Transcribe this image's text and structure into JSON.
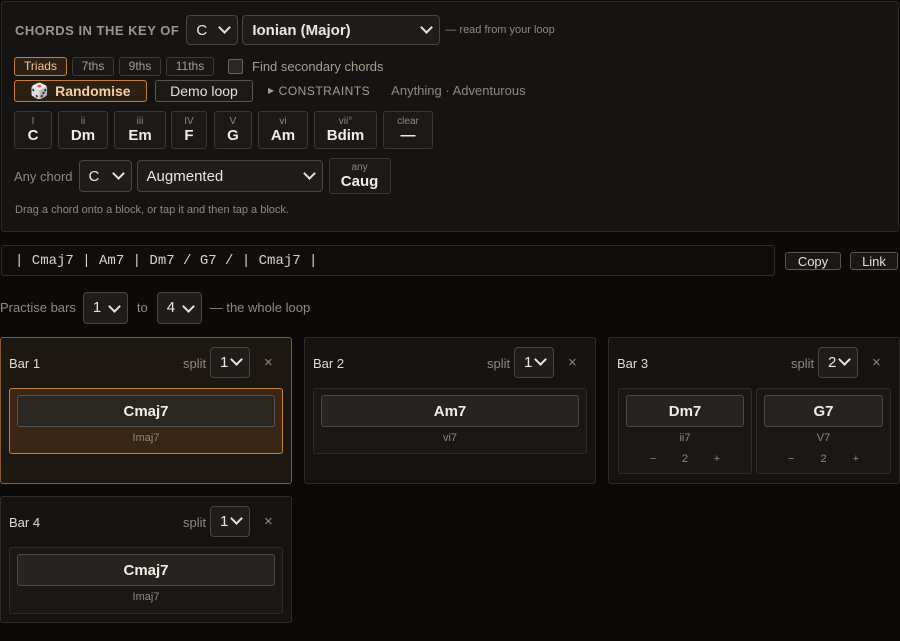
{
  "key_panel": {
    "heading": "CHORDS IN THE KEY OF",
    "key_value": "C",
    "mode_value": "Ionian (Major)",
    "mode_hint": "— read from your loop",
    "chord_types": [
      {
        "label": "Triads",
        "active": true
      },
      {
        "label": "7ths",
        "active": false
      },
      {
        "label": "9ths",
        "active": false
      },
      {
        "label": "11ths",
        "active": false
      }
    ],
    "secondary_label": "Find secondary chords",
    "randomise_label": "Randomise",
    "demo_label": "Demo loop",
    "constraints_label": "CONSTRAINTS",
    "constraints_summary": "Anything · Adventurous",
    "degrees": [
      {
        "num": "I",
        "name": "C"
      },
      {
        "num": "ii",
        "name": "Dm"
      },
      {
        "num": "iii",
        "name": "Em"
      },
      {
        "num": "IV",
        "name": "F"
      },
      {
        "num": "V",
        "name": "G"
      },
      {
        "num": "vi",
        "name": "Am"
      },
      {
        "num": "vii°",
        "name": "Bdim"
      },
      {
        "num": "clear",
        "name": "—"
      }
    ],
    "any_chord_label": "Any chord",
    "any_root": "C",
    "any_quality": "Augmented",
    "any_preview_num": "any",
    "any_preview_name": "Caug",
    "help_text": "Drag a chord onto a block, or tap it and then tap a block."
  },
  "progression": {
    "text": "| Cmaj7 | Am7 | Dm7 / G7 / | Cmaj7 |",
    "copy_label": "Copy",
    "link_label": "Link"
  },
  "practise": {
    "label": "Practise bars",
    "from": "1",
    "to_label": "to",
    "to": "4",
    "hint": "— the whole loop"
  },
  "bars": [
    {
      "title": "Bar 1",
      "split_label": "split",
      "split": "1",
      "close": "×",
      "slots": [
        {
          "chord": "Cmaj7",
          "roman": "Imaj7"
        }
      ]
    },
    {
      "title": "Bar 2",
      "split_label": "split",
      "split": "1",
      "close": "×",
      "slots": [
        {
          "chord": "Am7",
          "roman": "vi7"
        }
      ]
    },
    {
      "title": "Bar 3",
      "split_label": "split",
      "split": "2",
      "close": "×",
      "slots": [
        {
          "chord": "Dm7",
          "roman": "ii7",
          "minus": "−",
          "beats": "2",
          "plus": "+"
        },
        {
          "chord": "G7",
          "roman": "V7",
          "minus": "−",
          "beats": "2",
          "plus": "+"
        }
      ]
    },
    {
      "title": "Bar 4",
      "split_label": "split",
      "split": "1",
      "close": "×",
      "slots": [
        {
          "chord": "Cmaj7",
          "roman": "Imaj7"
        }
      ]
    }
  ],
  "colors": {
    "accent": "#c4803f",
    "background": "#0c0a09",
    "panel": "#161412"
  }
}
